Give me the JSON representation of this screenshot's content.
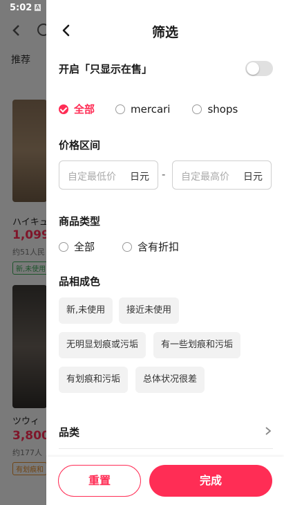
{
  "status_bar": {
    "time": "5:02",
    "notification_icon": "A"
  },
  "background": {
    "tab": "推荐",
    "items": [
      {
        "title": "ハイキュ",
        "price": "1,099",
        "meta": "约51人民",
        "tag": "新,未使用"
      },
      {
        "title": "ツウィ",
        "price": "3,800",
        "meta": "约177人",
        "tag": "有划痕和"
      }
    ]
  },
  "header": {
    "title": "筛选"
  },
  "on_sale": {
    "label": "开启「只显示在售」",
    "enabled": false
  },
  "source": {
    "options": [
      {
        "label": "全部",
        "selected": true
      },
      {
        "label": "mercari",
        "selected": false
      },
      {
        "label": "shops",
        "selected": false
      }
    ]
  },
  "price": {
    "title": "价格区间",
    "min_placeholder": "自定最低价",
    "max_placeholder": "自定最高价",
    "unit": "日元",
    "separator": "-"
  },
  "type": {
    "title": "商品类型",
    "options": [
      {
        "label": "全部",
        "selected": false
      },
      {
        "label": "含有折扣",
        "selected": false
      }
    ]
  },
  "condition": {
    "title": "品相成色",
    "chips": [
      "新,未使用",
      "接近未使用",
      "无明显划痕或污垢",
      "有一些划痕和污垢",
      "有划痕和污垢",
      "总体状况很差"
    ]
  },
  "category": {
    "title": "品类"
  },
  "actions": {
    "reset": "重置",
    "done": "完成"
  },
  "colors": {
    "accent": "#ff2d55"
  }
}
